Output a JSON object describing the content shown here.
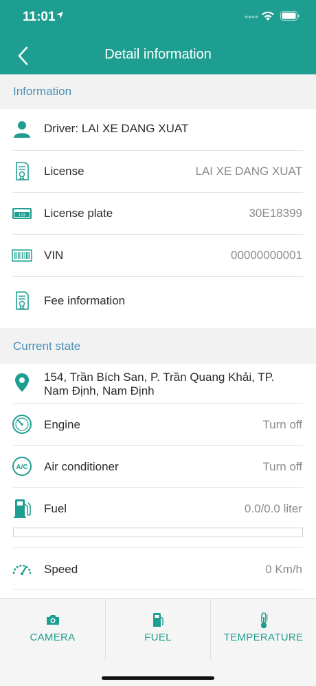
{
  "status_bar": {
    "time": "11:01"
  },
  "header": {
    "title": "Detail information"
  },
  "info_section": {
    "title": "Information",
    "rows": [
      {
        "icon": "person-icon",
        "label": "Driver: LAI XE DANG XUAT",
        "value": ""
      },
      {
        "icon": "license-certificate-icon",
        "label": "License",
        "value": "LAI XE DANG XUAT"
      },
      {
        "icon": "license-plate-icon",
        "label": "License plate",
        "value": "30E18399",
        "plate_text": "123"
      },
      {
        "icon": "barcode-icon",
        "label": "VIN",
        "value": "00000000001"
      },
      {
        "icon": "fee-certificate-icon",
        "label": "Fee information",
        "value": ""
      }
    ]
  },
  "state_section": {
    "title": "Current state",
    "address": "154, Trần Bích San, P. Trần Quang Khải, TP. Nam Định, Nam Định",
    "rows": [
      {
        "icon": "engine-gauge-icon",
        "label": "Engine",
        "value": "Turn off"
      },
      {
        "icon": "ac-icon",
        "label": "Air conditioner",
        "value": "Turn off",
        "icon_text": "A/C"
      },
      {
        "icon": "fuel-pump-icon",
        "label": "Fuel",
        "value": "0.0/0.0 liter"
      },
      {
        "icon": "speedometer-icon",
        "label": "Speed",
        "value": "0 Km/h"
      }
    ],
    "fuel_level": 0
  },
  "tabs": [
    {
      "icon": "camera-icon",
      "label": "CAMERA"
    },
    {
      "icon": "fuel-icon",
      "label": "FUEL"
    },
    {
      "icon": "thermometer-icon",
      "label": "TEMPERATURE"
    }
  ],
  "colors": {
    "accent": "#1e9e90",
    "section_title": "#4a8fb5",
    "value_text": "#8b8b8b"
  }
}
